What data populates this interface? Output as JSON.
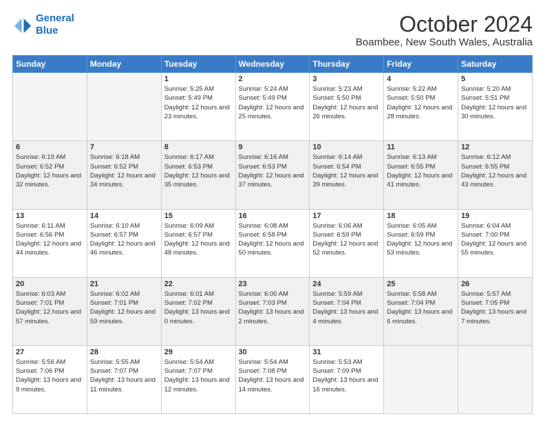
{
  "header": {
    "logo_line1": "General",
    "logo_line2": "Blue",
    "main_title": "October 2024",
    "subtitle": "Boambee, New South Wales, Australia"
  },
  "calendar": {
    "days_of_week": [
      "Sunday",
      "Monday",
      "Tuesday",
      "Wednesday",
      "Thursday",
      "Friday",
      "Saturday"
    ],
    "weeks": [
      [
        {
          "day": "",
          "empty": true
        },
        {
          "day": "",
          "empty": true
        },
        {
          "day": "1",
          "sunrise": "Sunrise: 5:25 AM",
          "sunset": "Sunset: 5:49 PM",
          "daylight": "Daylight: 12 hours and 23 minutes."
        },
        {
          "day": "2",
          "sunrise": "Sunrise: 5:24 AM",
          "sunset": "Sunset: 5:49 PM",
          "daylight": "Daylight: 12 hours and 25 minutes."
        },
        {
          "day": "3",
          "sunrise": "Sunrise: 5:23 AM",
          "sunset": "Sunset: 5:50 PM",
          "daylight": "Daylight: 12 hours and 26 minutes."
        },
        {
          "day": "4",
          "sunrise": "Sunrise: 5:22 AM",
          "sunset": "Sunset: 5:50 PM",
          "daylight": "Daylight: 12 hours and 28 minutes."
        },
        {
          "day": "5",
          "sunrise": "Sunrise: 5:20 AM",
          "sunset": "Sunset: 5:51 PM",
          "daylight": "Daylight: 12 hours and 30 minutes."
        }
      ],
      [
        {
          "day": "6",
          "sunrise": "Sunrise: 6:19 AM",
          "sunset": "Sunset: 6:52 PM",
          "daylight": "Daylight: 12 hours and 32 minutes."
        },
        {
          "day": "7",
          "sunrise": "Sunrise: 6:18 AM",
          "sunset": "Sunset: 6:52 PM",
          "daylight": "Daylight: 12 hours and 34 minutes."
        },
        {
          "day": "8",
          "sunrise": "Sunrise: 6:17 AM",
          "sunset": "Sunset: 6:53 PM",
          "daylight": "Daylight: 12 hours and 35 minutes."
        },
        {
          "day": "9",
          "sunrise": "Sunrise: 6:16 AM",
          "sunset": "Sunset: 6:53 PM",
          "daylight": "Daylight: 12 hours and 37 minutes."
        },
        {
          "day": "10",
          "sunrise": "Sunrise: 6:14 AM",
          "sunset": "Sunset: 6:54 PM",
          "daylight": "Daylight: 12 hours and 39 minutes."
        },
        {
          "day": "11",
          "sunrise": "Sunrise: 6:13 AM",
          "sunset": "Sunset: 6:55 PM",
          "daylight": "Daylight: 12 hours and 41 minutes."
        },
        {
          "day": "12",
          "sunrise": "Sunrise: 6:12 AM",
          "sunset": "Sunset: 6:55 PM",
          "daylight": "Daylight: 12 hours and 43 minutes."
        }
      ],
      [
        {
          "day": "13",
          "sunrise": "Sunrise: 6:11 AM",
          "sunset": "Sunset: 6:56 PM",
          "daylight": "Daylight: 12 hours and 44 minutes."
        },
        {
          "day": "14",
          "sunrise": "Sunrise: 6:10 AM",
          "sunset": "Sunset: 6:57 PM",
          "daylight": "Daylight: 12 hours and 46 minutes."
        },
        {
          "day": "15",
          "sunrise": "Sunrise: 6:09 AM",
          "sunset": "Sunset: 6:57 PM",
          "daylight": "Daylight: 12 hours and 48 minutes."
        },
        {
          "day": "16",
          "sunrise": "Sunrise: 6:08 AM",
          "sunset": "Sunset: 6:58 PM",
          "daylight": "Daylight: 12 hours and 50 minutes."
        },
        {
          "day": "17",
          "sunrise": "Sunrise: 6:06 AM",
          "sunset": "Sunset: 6:59 PM",
          "daylight": "Daylight: 12 hours and 52 minutes."
        },
        {
          "day": "18",
          "sunrise": "Sunrise: 6:05 AM",
          "sunset": "Sunset: 6:59 PM",
          "daylight": "Daylight: 12 hours and 53 minutes."
        },
        {
          "day": "19",
          "sunrise": "Sunrise: 6:04 AM",
          "sunset": "Sunset: 7:00 PM",
          "daylight": "Daylight: 12 hours and 55 minutes."
        }
      ],
      [
        {
          "day": "20",
          "sunrise": "Sunrise: 6:03 AM",
          "sunset": "Sunset: 7:01 PM",
          "daylight": "Daylight: 12 hours and 57 minutes."
        },
        {
          "day": "21",
          "sunrise": "Sunrise: 6:02 AM",
          "sunset": "Sunset: 7:01 PM",
          "daylight": "Daylight: 12 hours and 59 minutes."
        },
        {
          "day": "22",
          "sunrise": "Sunrise: 6:01 AM",
          "sunset": "Sunset: 7:02 PM",
          "daylight": "Daylight: 13 hours and 0 minutes."
        },
        {
          "day": "23",
          "sunrise": "Sunrise: 6:00 AM",
          "sunset": "Sunset: 7:03 PM",
          "daylight": "Daylight: 13 hours and 2 minutes."
        },
        {
          "day": "24",
          "sunrise": "Sunrise: 5:59 AM",
          "sunset": "Sunset: 7:04 PM",
          "daylight": "Daylight: 13 hours and 4 minutes."
        },
        {
          "day": "25",
          "sunrise": "Sunrise: 5:58 AM",
          "sunset": "Sunset: 7:04 PM",
          "daylight": "Daylight: 13 hours and 6 minutes."
        },
        {
          "day": "26",
          "sunrise": "Sunrise: 5:57 AM",
          "sunset": "Sunset: 7:05 PM",
          "daylight": "Daylight: 13 hours and 7 minutes."
        }
      ],
      [
        {
          "day": "27",
          "sunrise": "Sunrise: 5:56 AM",
          "sunset": "Sunset: 7:06 PM",
          "daylight": "Daylight: 13 hours and 9 minutes."
        },
        {
          "day": "28",
          "sunrise": "Sunrise: 5:55 AM",
          "sunset": "Sunset: 7:07 PM",
          "daylight": "Daylight: 13 hours and 11 minutes."
        },
        {
          "day": "29",
          "sunrise": "Sunrise: 5:54 AM",
          "sunset": "Sunset: 7:07 PM",
          "daylight": "Daylight: 13 hours and 12 minutes."
        },
        {
          "day": "30",
          "sunrise": "Sunrise: 5:54 AM",
          "sunset": "Sunset: 7:08 PM",
          "daylight": "Daylight: 13 hours and 14 minutes."
        },
        {
          "day": "31",
          "sunrise": "Sunrise: 5:53 AM",
          "sunset": "Sunset: 7:09 PM",
          "daylight": "Daylight: 13 hours and 16 minutes."
        },
        {
          "day": "",
          "empty": true
        },
        {
          "day": "",
          "empty": true
        }
      ]
    ]
  }
}
